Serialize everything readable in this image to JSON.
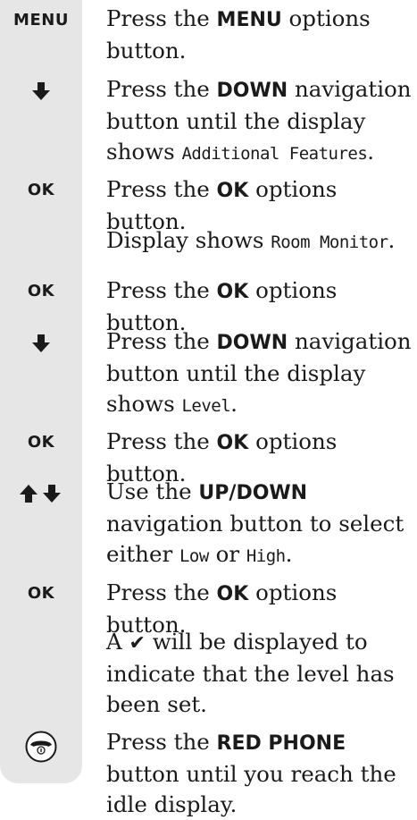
{
  "steps": [
    {
      "icon": "MENU",
      "pre": "Press the ",
      "bold": "MENU",
      "post": " options button."
    },
    {
      "icon": "down-arrow",
      "pre": "Press the ",
      "bold": "DOWN",
      "mid": " navigation button until the display shows ",
      "lcd": "Additional Features",
      "post": "."
    },
    {
      "icon": "OK",
      "pre": "Press the ",
      "bold": "OK",
      "post": " options button."
    },
    {
      "pre": "Display shows ",
      "lcd": "Room Monitor",
      "post": "."
    },
    {
      "icon": "OK",
      "pre": "Press the ",
      "bold": "OK",
      "post": " options button."
    },
    {
      "icon": "down-arrow",
      "pre": "Press the ",
      "bold": "DOWN",
      "mid": " navigation button until the display shows ",
      "lcd": "Level",
      "post": "."
    },
    {
      "icon": "OK",
      "pre": "Press the ",
      "bold": "OK",
      "post": " options button."
    },
    {
      "icon": "up-down-arrows",
      "pre": "Use the ",
      "bold": "UP/DOWN",
      "mid": " navigation button to select either ",
      "lcd": "Low",
      "mid2": " or ",
      "lcd2": "High",
      "post": "."
    },
    {
      "icon": "OK",
      "pre": "Press the ",
      "bold": "OK",
      "post": " options button."
    },
    {
      "pre": "A ",
      "check": "✔",
      "post": " will be displayed to indicate that the level has been set."
    },
    {
      "icon": "red-phone",
      "pre": "Press the ",
      "bold": "RED PHONE",
      "post": " button until you reach the idle display."
    }
  ]
}
